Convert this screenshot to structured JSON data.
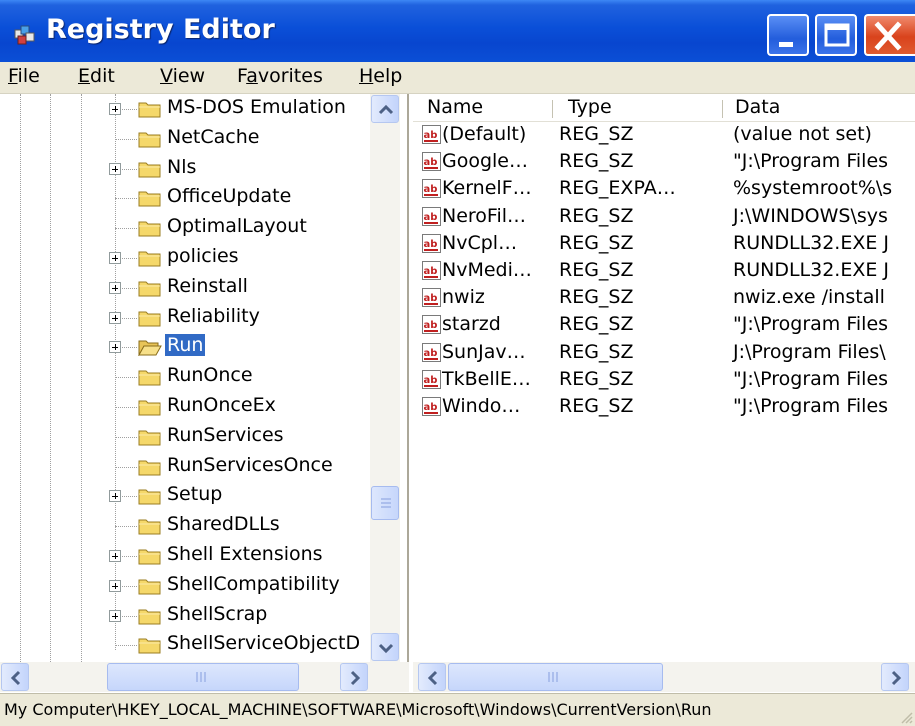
{
  "window": {
    "title": "Registry Editor"
  },
  "menu": [
    {
      "label": "File",
      "accel": "F",
      "rest": "ile"
    },
    {
      "label": "Edit",
      "accel": "E",
      "rest": "dit"
    },
    {
      "label": "View",
      "accel": "V",
      "rest": "iew"
    },
    {
      "label": "Favorites",
      "pre": "F",
      "accel": "a",
      "rest": "vorites"
    },
    {
      "label": "Help",
      "accel": "H",
      "rest": "elp"
    }
  ],
  "tree": {
    "items": [
      {
        "label": "MS-DOS Emulation",
        "expandable": true
      },
      {
        "label": "NetCache",
        "expandable": false
      },
      {
        "label": "Nls",
        "expandable": true
      },
      {
        "label": "OfficeUpdate",
        "expandable": false
      },
      {
        "label": "OptimalLayout",
        "expandable": false
      },
      {
        "label": "policies",
        "expandable": true
      },
      {
        "label": "Reinstall",
        "expandable": true
      },
      {
        "label": "Reliability",
        "expandable": true
      },
      {
        "label": "Run",
        "expandable": true,
        "selected": true
      },
      {
        "label": "RunOnce",
        "expandable": false
      },
      {
        "label": "RunOnceEx",
        "expandable": false
      },
      {
        "label": "RunServices",
        "expandable": false
      },
      {
        "label": "RunServicesOnce",
        "expandable": false
      },
      {
        "label": "Setup",
        "expandable": true
      },
      {
        "label": "SharedDLLs",
        "expandable": false
      },
      {
        "label": "Shell Extensions",
        "expandable": true
      },
      {
        "label": "ShellCompatibility",
        "expandable": true
      },
      {
        "label": "ShellScrap",
        "expandable": true
      },
      {
        "label": "ShellServiceObjectD",
        "expandable": false
      }
    ]
  },
  "list": {
    "columns": {
      "name": "Name",
      "type": "Type",
      "data": "Data"
    },
    "rows": [
      {
        "name": "(Default)",
        "type": "REG_SZ",
        "data": "(value not set)"
      },
      {
        "name": "Google…",
        "type": "REG_SZ",
        "data": "\"J:\\Program Files"
      },
      {
        "name": "KernelF…",
        "type": "REG_EXPA…",
        "data": "%systemroot%\\s"
      },
      {
        "name": "NeroFil…",
        "type": "REG_SZ",
        "data": "J:\\WINDOWS\\sys"
      },
      {
        "name": "NvCpl…",
        "type": "REG_SZ",
        "data": "RUNDLL32.EXE J"
      },
      {
        "name": "NvMedi…",
        "type": "REG_SZ",
        "data": "RUNDLL32.EXE J"
      },
      {
        "name": "nwiz",
        "type": "REG_SZ",
        "data": "nwiz.exe /install"
      },
      {
        "name": "starzd",
        "type": "REG_SZ",
        "data": "\"J:\\Program Files"
      },
      {
        "name": "SunJav…",
        "type": "REG_SZ",
        "data": "J:\\Program Files\\"
      },
      {
        "name": "TkBellE…",
        "type": "REG_SZ",
        "data": "\"J:\\Program Files"
      },
      {
        "name": "Windo…",
        "type": "REG_SZ",
        "data": "\"J:\\Program Files"
      }
    ]
  },
  "status": {
    "path": "My Computer\\HKEY_LOCAL_MACHINE\\SOFTWARE\\Microsoft\\Windows\\CurrentVersion\\Run"
  },
  "colors": {
    "titlebar": "#0a4fd8",
    "selection": "#316ac5",
    "folder": "#f5d86a",
    "close_button": "#d9431c",
    "chrome": "#ece9d8"
  },
  "icons": {
    "title": "registry-editor-icon",
    "folder": "folder-icon",
    "folder_open": "folder-open-icon",
    "value": "string-value-icon"
  }
}
